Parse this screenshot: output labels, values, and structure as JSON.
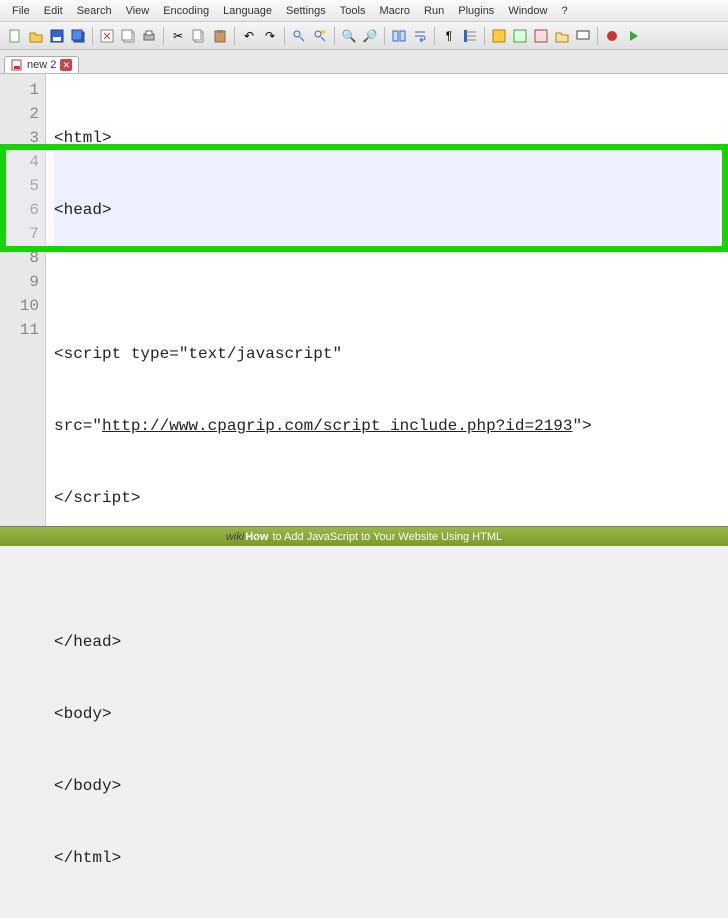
{
  "menubar": [
    "File",
    "Edit",
    "Search",
    "View",
    "Encoding",
    "Language",
    "Settings",
    "Tools",
    "Macro",
    "Run",
    "Plugins",
    "Window",
    "?"
  ],
  "tab": {
    "label": "new 2"
  },
  "gutter_lines": [
    "1",
    "2",
    "3",
    "4",
    "5",
    "6",
    "7",
    "8",
    "9",
    "10",
    "11"
  ],
  "code_lines": {
    "l1": "<html>",
    "l2": "<head>",
    "l3": "",
    "l4": "<script type=\"text/javascript\"",
    "l5a": "src=\"",
    "l5b": "http://www.cpagrip.com/script_include.php?id=2193",
    "l5c": "\">",
    "l6": "</script>",
    "l7": "",
    "l8": "</head>",
    "l9": "<body>",
    "l10": "</body>",
    "l11": "</html>"
  },
  "caption": {
    "wiki": "wiki",
    "how": "How",
    "text": " to Add JavaScript to Your Website Using HTML"
  }
}
